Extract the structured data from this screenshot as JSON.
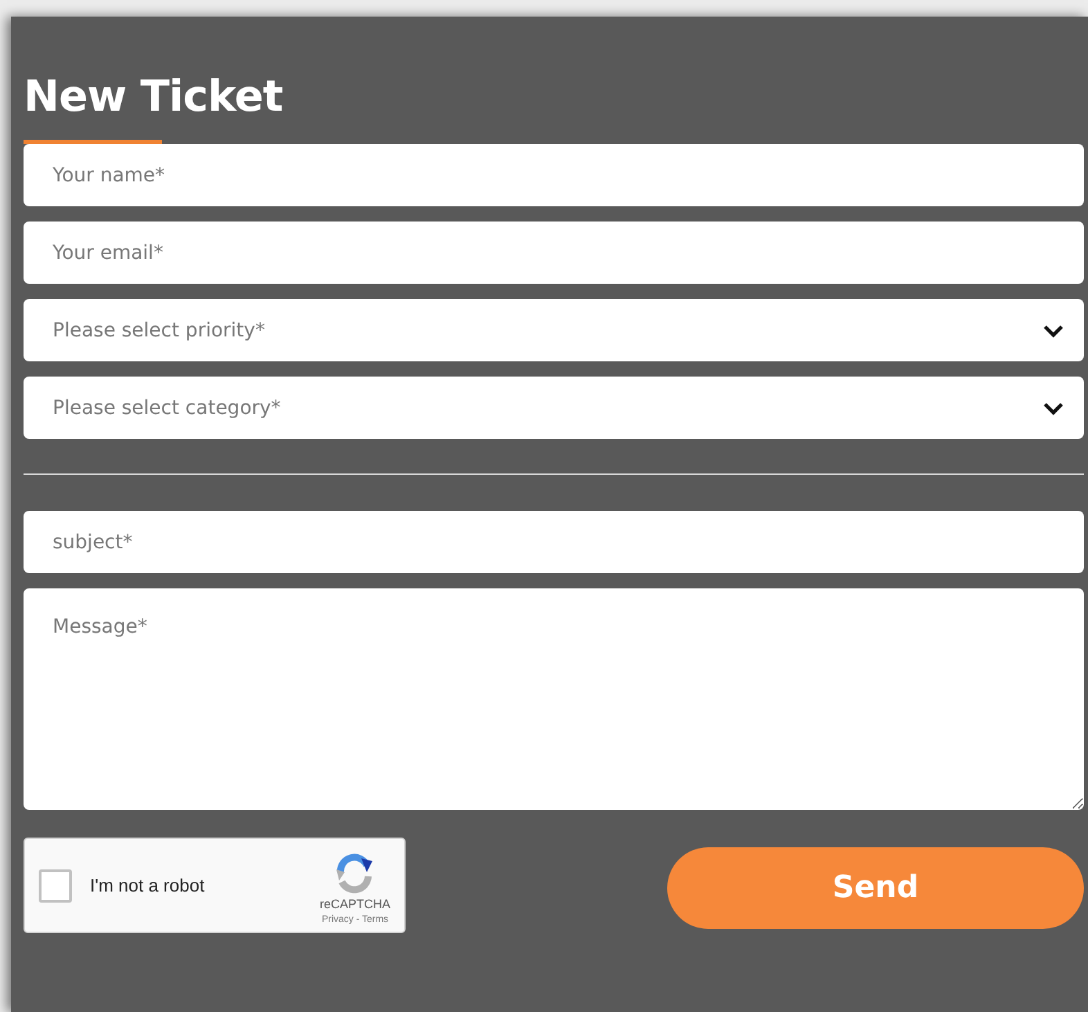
{
  "title": "New Ticket",
  "contact_fields": [
    {
      "kind": "text",
      "placeholder": "Your name*"
    },
    {
      "kind": "text",
      "placeholder": "Your email*"
    },
    {
      "kind": "select",
      "placeholder": "Please select priority*"
    },
    {
      "kind": "select",
      "placeholder": "Please select category*"
    }
  ],
  "ticket_fields": [
    {
      "kind": "text",
      "placeholder": "subject*"
    },
    {
      "kind": "textarea",
      "placeholder": "Message*"
    }
  ],
  "captcha": {
    "label": "I'm not a robot",
    "checked": false,
    "brand": "reCAPTCHA",
    "links": "Privacy - Terms"
  },
  "submit_button": "Send"
}
